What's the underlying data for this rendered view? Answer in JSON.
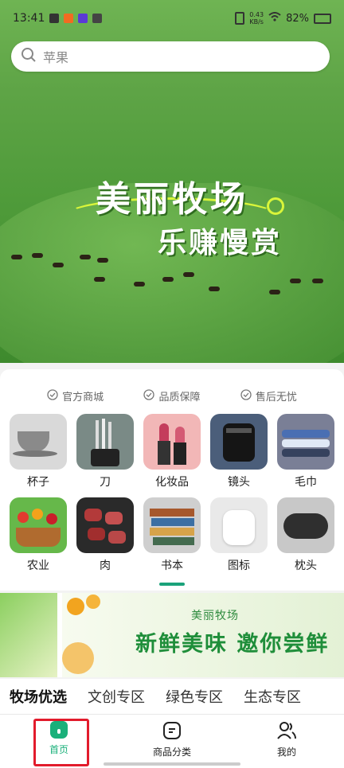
{
  "status_bar": {
    "time": "13:41",
    "network_speed_value": "0.43",
    "network_speed_unit": "KB/s",
    "battery": "82%"
  },
  "search": {
    "placeholder": "苹果"
  },
  "hero_banner": {
    "title": "美丽牧场",
    "subtitle": "乐赚慢赏"
  },
  "guarantees": [
    {
      "label": "官方商城",
      "icon": "check-circle-icon"
    },
    {
      "label": "品质保障",
      "icon": "check-circle-icon"
    },
    {
      "label": "售后无忧",
      "icon": "check-circle-icon"
    }
  ],
  "categories": [
    {
      "label": "杯子",
      "color": "#d9d9d9"
    },
    {
      "label": "刀",
      "color": "#7a8a86"
    },
    {
      "label": "化妆品",
      "color": "#f2b7b7"
    },
    {
      "label": "镜头",
      "color": "#4b5e7a"
    },
    {
      "label": "毛巾",
      "color": "#7a7f96"
    },
    {
      "label": "农业",
      "color": "#66b84a"
    },
    {
      "label": "肉",
      "color": "#2a2a2a"
    },
    {
      "label": "书本",
      "color": "#cfcfcf"
    },
    {
      "label": "图标",
      "color": "#e9e9e9"
    },
    {
      "label": "枕头",
      "color": "#c8c8c8"
    }
  ],
  "active_category": "书本",
  "promo_banner": {
    "subtitle": "美丽牧场",
    "headline": "新鲜美味 邀你尝鲜"
  },
  "section_tabs": [
    "牧场优选",
    "文创专区",
    "绿色专区",
    "生态专区"
  ],
  "active_section_tab": "牧场优选",
  "bottom_nav": {
    "home": "首页",
    "categories": "商品分类",
    "mine": "我的"
  },
  "colors": {
    "accent": "#1ab07a",
    "highlight_box": "#e21b2c"
  }
}
